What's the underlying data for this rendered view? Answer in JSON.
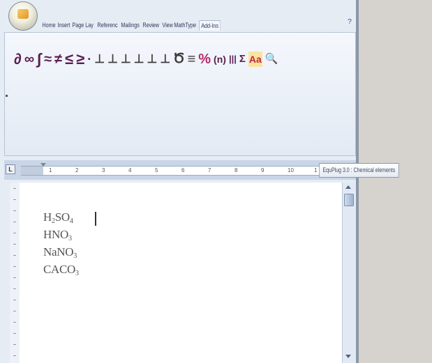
{
  "ribbon": {
    "tabs": [
      {
        "label": "Home",
        "active": false
      },
      {
        "label": "Insert",
        "active": false
      },
      {
        "label": "Page Lay",
        "active": false
      },
      {
        "label": "Referenc",
        "active": false
      },
      {
        "label": "Mailings",
        "active": false
      },
      {
        "label": "Review",
        "active": false
      },
      {
        "label": "View",
        "active": false
      },
      {
        "label": "MathType",
        "active": false
      },
      {
        "label": "Add-Ins",
        "active": true
      }
    ],
    "help_glyph": "?",
    "symbols": [
      {
        "glyph": "∂",
        "name": "partial-derivative-icon",
        "color": "#5a1e50"
      },
      {
        "glyph": "∞",
        "name": "infinity-icon",
        "color": "#5a1e50"
      },
      {
        "glyph": "∫",
        "name": "integral-icon",
        "color": "#5a1e50"
      },
      {
        "glyph": "≈",
        "name": "approx-equal-icon",
        "color": "#5a1e50"
      },
      {
        "glyph": "≠",
        "name": "not-equal-icon",
        "color": "#5a1e50"
      },
      {
        "glyph": "≤",
        "name": "less-equal-icon",
        "color": "#5a1e50"
      },
      {
        "glyph": "≥",
        "name": "greater-equal-icon",
        "color": "#5a1e50"
      },
      {
        "glyph": "·",
        "name": "middle-dot-icon",
        "color": "#5a1e50"
      },
      {
        "glyph": "⊥",
        "name": "script-layout-icon-1",
        "color": "#3b3b3b"
      },
      {
        "glyph": "⊥",
        "name": "script-layout-icon-2",
        "color": "#3b3b3b"
      },
      {
        "glyph": "⊥",
        "name": "script-layout-icon-3",
        "color": "#3b3b3b"
      },
      {
        "glyph": "⊥",
        "name": "script-layout-icon-4",
        "color": "#3b3b3b"
      },
      {
        "glyph": "⊥",
        "name": "script-layout-icon-5",
        "color": "#3b3b3b"
      },
      {
        "glyph": "⊥",
        "name": "script-layout-icon-6",
        "color": "#3b3b3b"
      },
      {
        "glyph": "Ծ",
        "name": "arc-icon",
        "color": "#3b3b3b"
      },
      {
        "glyph": "≡",
        "name": "identical-icon",
        "color": "#3b3b3b"
      },
      {
        "glyph": "%",
        "name": "fraction-icon",
        "color": "#b42a6a"
      },
      {
        "glyph": "(n)",
        "name": "parenthesis-icon",
        "color": "#5a1e50"
      },
      {
        "glyph": "|||",
        "name": "matrix-icon",
        "color": "#5a1e50"
      },
      {
        "glyph": "Σ",
        "name": "sum-icon",
        "color": "#5a1e50"
      },
      {
        "glyph": "Aa",
        "name": "chemical-elements-icon",
        "color": "#c0283c"
      },
      {
        "glyph": "🔍",
        "name": "magnifier-icon",
        "color": "#3a5c96"
      }
    ]
  },
  "ruler": {
    "corner_glyph": "L",
    "numbers": [
      "1",
      "2",
      "3",
      "4",
      "5",
      "6",
      "7",
      "8",
      "9",
      "10",
      "1"
    ]
  },
  "tooltip": {
    "text": "EquPlug 3.0 : Chemical elements"
  },
  "document": {
    "lines": [
      {
        "main": "H",
        "sub1": "2",
        "mid": "SO",
        "sub2": "4"
      },
      {
        "main": "HNO",
        "sub1": "3",
        "mid": "",
        "sub2": ""
      },
      {
        "main": "NaNO",
        "sub1": "3",
        "mid": "",
        "sub2": ""
      },
      {
        "main": "CACO",
        "sub1": "3",
        "mid": "",
        "sub2": ""
      }
    ]
  },
  "colors": {
    "ribbon_bg": "#e6ecf4",
    "right_gray": "#d6d3cf",
    "text": "#555555"
  }
}
